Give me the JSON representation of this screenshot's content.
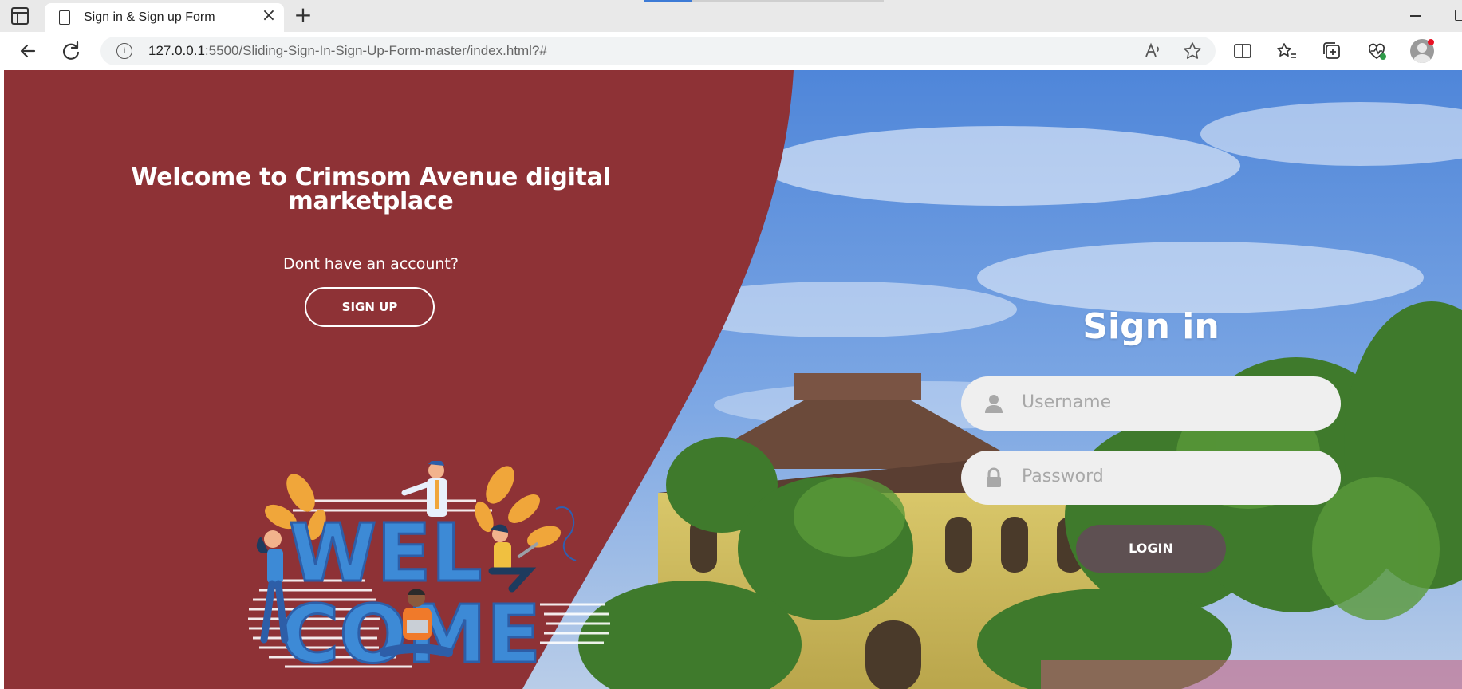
{
  "browser": {
    "tab_title": "Sign in & Sign up Form",
    "tab_close": "×",
    "new_tab": "+",
    "url_host": "127.0.0.1",
    "url_rest": ":5500/Sliding-Sign-In-Sign-Up-Form-master/index.html?#",
    "info_glyph": "i"
  },
  "left_panel": {
    "title": "Welcome to Crimsom Avenue digital marketplace",
    "prompt": "Dont have an account?",
    "signup_label": "SIGN UP",
    "art_letters_top": "WEL",
    "art_letters_bottom": "COME"
  },
  "signin": {
    "title": "Sign in",
    "username_placeholder": "Username",
    "password_placeholder": "Password",
    "login_label": "LOGIN"
  },
  "colors": {
    "crimson": "#8e3236",
    "login_button": "#5e5052",
    "field_bg": "#efefef"
  }
}
